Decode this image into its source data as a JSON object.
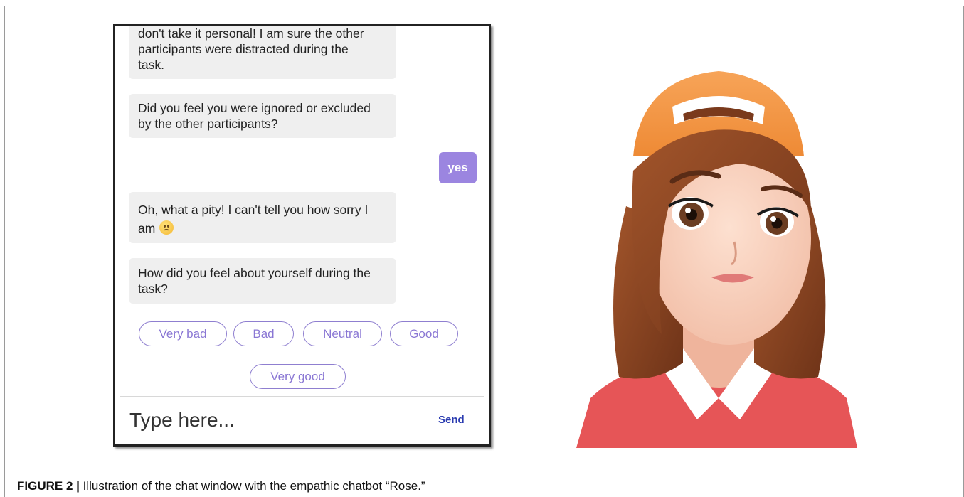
{
  "chat": {
    "messages": [
      {
        "sender": "bot",
        "lines": [
          "don't take it personal! I am sure the other",
          "participants were distracted during the",
          "task."
        ]
      },
      {
        "sender": "bot",
        "lines": [
          "Did you feel you were ignored or excluded",
          "by the other participants?"
        ]
      },
      {
        "sender": "user",
        "text": "yes"
      },
      {
        "sender": "bot",
        "lines": [
          "Oh, what a pity! I can't tell you how sorry I",
          "am"
        ],
        "emoji": "sad-face-icon"
      },
      {
        "sender": "bot",
        "lines": [
          "How did you feel about yourself during the",
          "task?"
        ]
      }
    ],
    "quick_replies": [
      "Very bad",
      "Bad",
      "Neutral",
      "Good",
      "Very good"
    ],
    "input_placeholder": "Type here...",
    "send_label": "Send",
    "colors": {
      "user_bubble": "#9b85e0",
      "bot_bubble": "#efefef",
      "reply_border": "#8f7fd0",
      "send": "#2a3bb0"
    }
  },
  "avatar": {
    "icon": "chatbot-avatar-rose"
  },
  "caption": {
    "label": "FIGURE 2 |",
    "text": " Illustration of the chat window with the empathic chatbot “Rose.”"
  }
}
